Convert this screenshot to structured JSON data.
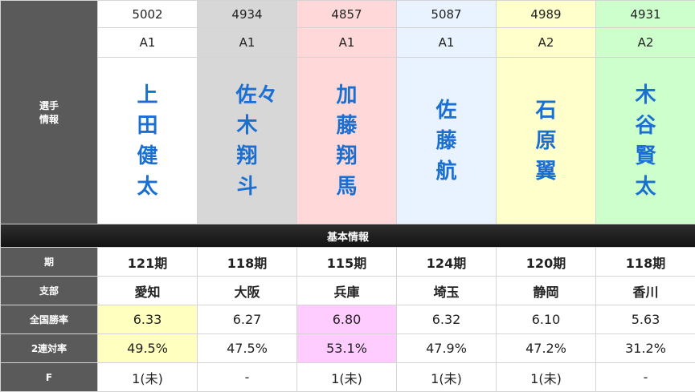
{
  "labels": {
    "racer_info": "選手\n情報",
    "basic_info": "基本情報",
    "period": "期",
    "branch": "支部",
    "national_win_rate": "全国勝率",
    "quinella_rate": "2連対率",
    "f": "F"
  },
  "racers": [
    {
      "number": "5002",
      "class": "A1",
      "name": "上田健太",
      "period": "121期",
      "branch": "愛知",
      "win_rate": "6.33",
      "quinella": "49.5%",
      "f": "1(未)",
      "bg": "#ffffff"
    },
    {
      "number": "4934",
      "class": "A1",
      "name": "佐々木翔斗",
      "period": "118期",
      "branch": "大阪",
      "win_rate": "6.27",
      "quinella": "47.5%",
      "f": "-",
      "bg": "#d7d7d7"
    },
    {
      "number": "4857",
      "class": "A1",
      "name": "加藤翔馬",
      "period": "115期",
      "branch": "兵庫",
      "win_rate": "6.80",
      "quinella": "53.1%",
      "f": "1(未)",
      "bg": "#ffd9d9"
    },
    {
      "number": "5087",
      "class": "A1",
      "name": "佐藤航",
      "period": "124期",
      "branch": "埼玉",
      "win_rate": "6.32",
      "quinella": "47.9%",
      "f": "1(未)",
      "bg": "#e8f3ff"
    },
    {
      "number": "4989",
      "class": "A2",
      "name": "石原翼",
      "period": "120期",
      "branch": "静岡",
      "win_rate": "6.10",
      "quinella": "47.2%",
      "f": "1(未)",
      "bg": "#ffffcc"
    },
    {
      "number": "4931",
      "class": "A2",
      "name": "木谷賢太",
      "period": "118期",
      "branch": "香川",
      "win_rate": "5.63",
      "quinella": "31.2%",
      "f": "-",
      "bg": "#ccffcc"
    }
  ],
  "highlights": {
    "win_rate": {
      "0": "yellow",
      "2": "pink"
    },
    "quinella": {
      "0": "yellow",
      "2": "pink"
    }
  }
}
